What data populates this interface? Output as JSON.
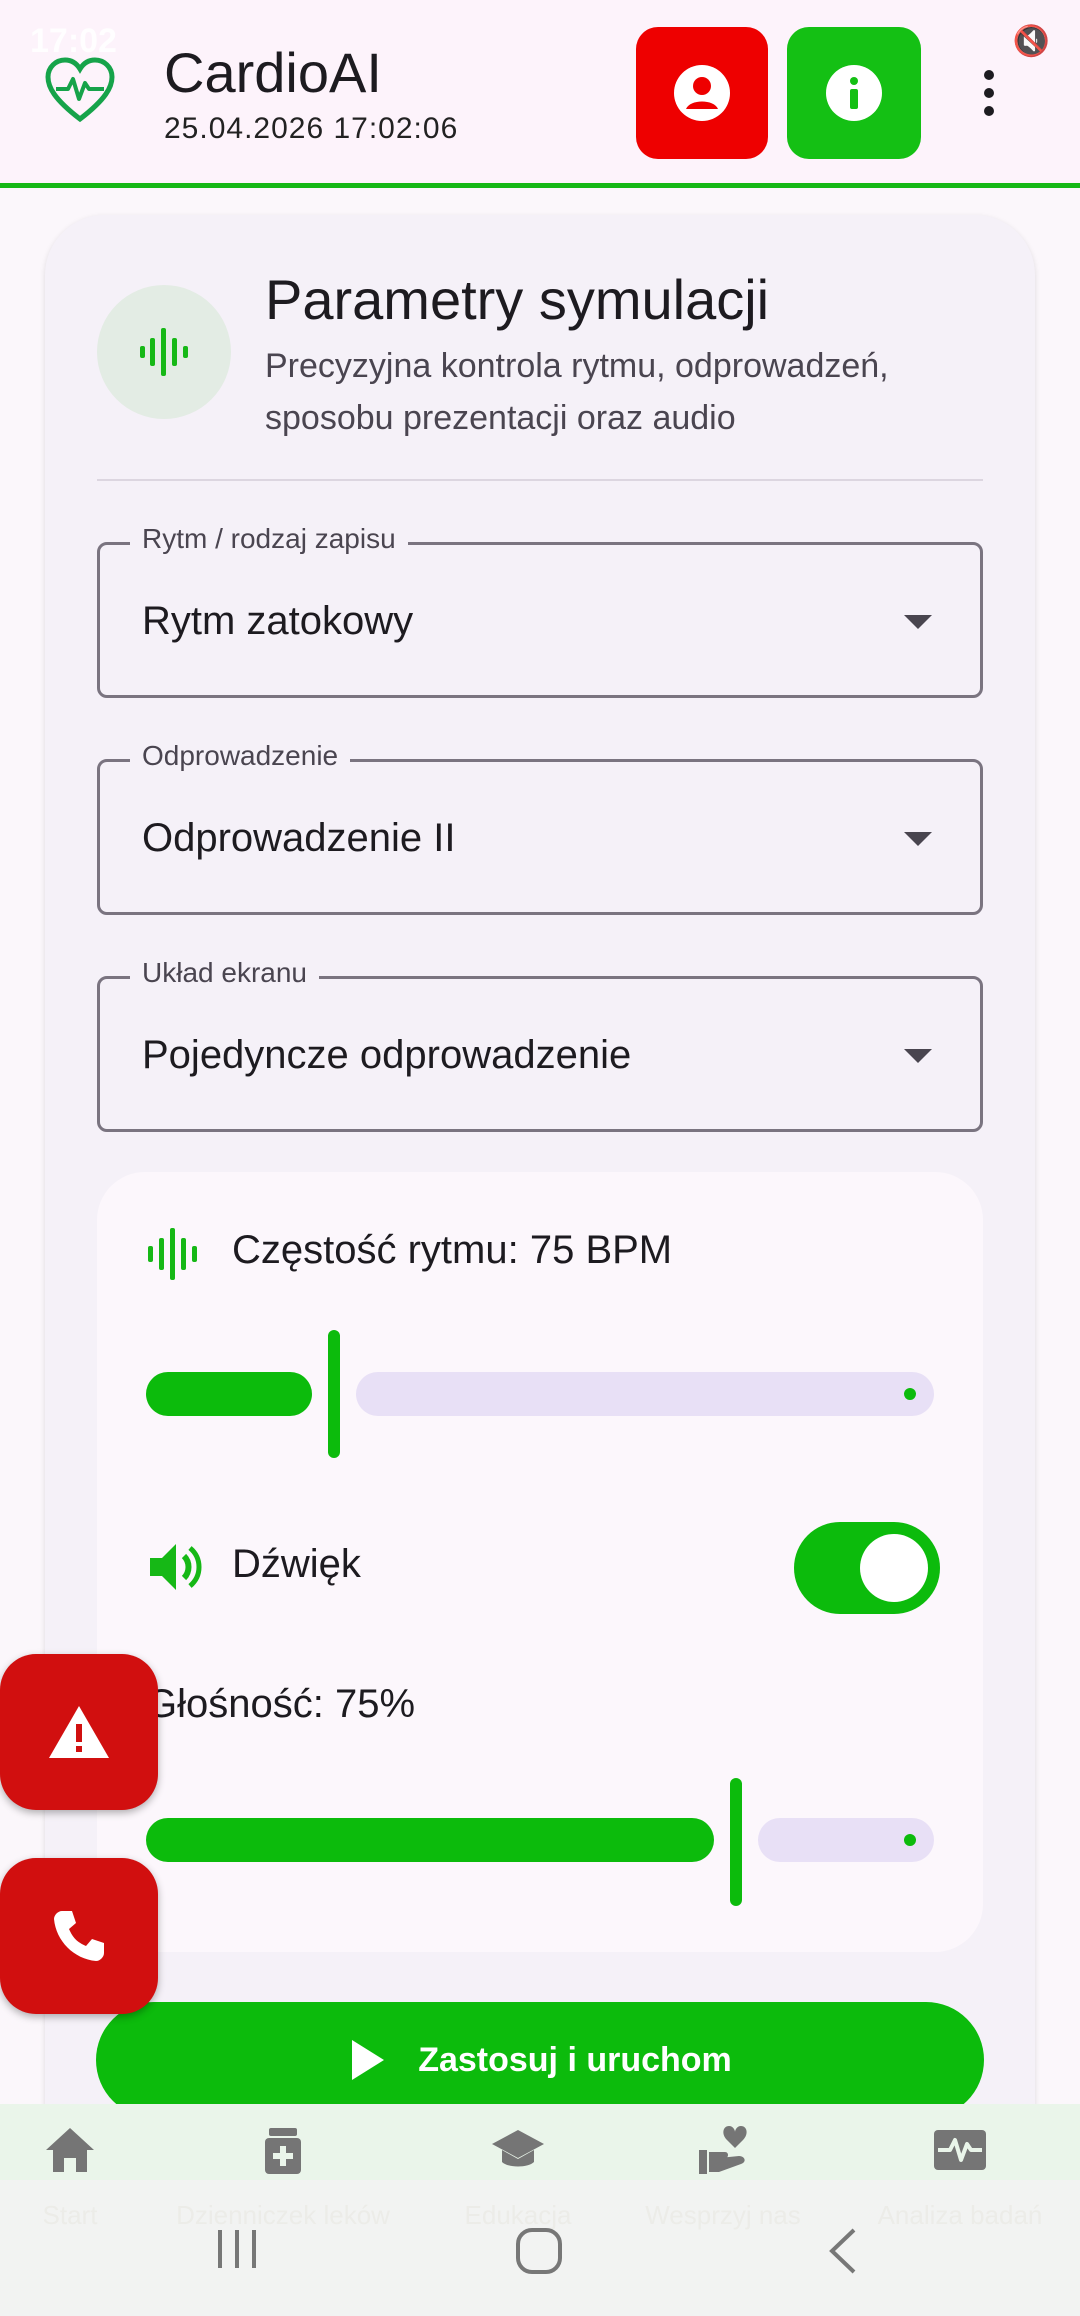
{
  "status_bar": {
    "time": "17:02"
  },
  "app_bar": {
    "title": "CardioAI",
    "datetime": "25.04.2026 17:02:06",
    "profile_icon": "account-circle-icon",
    "info_icon": "info-icon",
    "menu_icon": "more-vert-icon",
    "colors": {
      "profile": "#ee0000",
      "info": "#14c014",
      "accent": "#16b816"
    }
  },
  "card": {
    "title": "Parametry symulacji",
    "subtitle": "Precyzyjna kontrola rytmu, odprowadzeń, sposobu prezentacji oraz audio",
    "rhythm": {
      "label": "Rytm / rodzaj zapisu",
      "value": "Rytm zatokowy"
    },
    "lead": {
      "label": "Odprowadzenie",
      "value": "Odprowadzenie II"
    },
    "layout": {
      "label": "Układ ekranu",
      "value": "Pojedyncze odprowadzenie"
    },
    "heart_rate": {
      "label": "Częstość rytmu: 75 BPM",
      "slider_fraction": 0.24
    },
    "sound": {
      "label": "Dźwięk",
      "enabled": true
    },
    "volume": {
      "label": "Głośność: 75%",
      "slider_fraction": 0.75
    },
    "apply_label": "Zastosuj i uruchom"
  },
  "fabs": {
    "warning_icon": "warning-icon",
    "phone_icon": "phone-icon"
  },
  "bottom_nav": {
    "items": [
      {
        "label": "Start",
        "icon": "home-icon"
      },
      {
        "label": "Dzienniczek leków",
        "icon": "medication-icon"
      },
      {
        "label": "Edukacja",
        "icon": "school-icon"
      },
      {
        "label": "Wesprzyj nas",
        "icon": "volunteer-icon"
      },
      {
        "label": "Analiza badań",
        "icon": "monitor-heart-icon"
      }
    ]
  }
}
